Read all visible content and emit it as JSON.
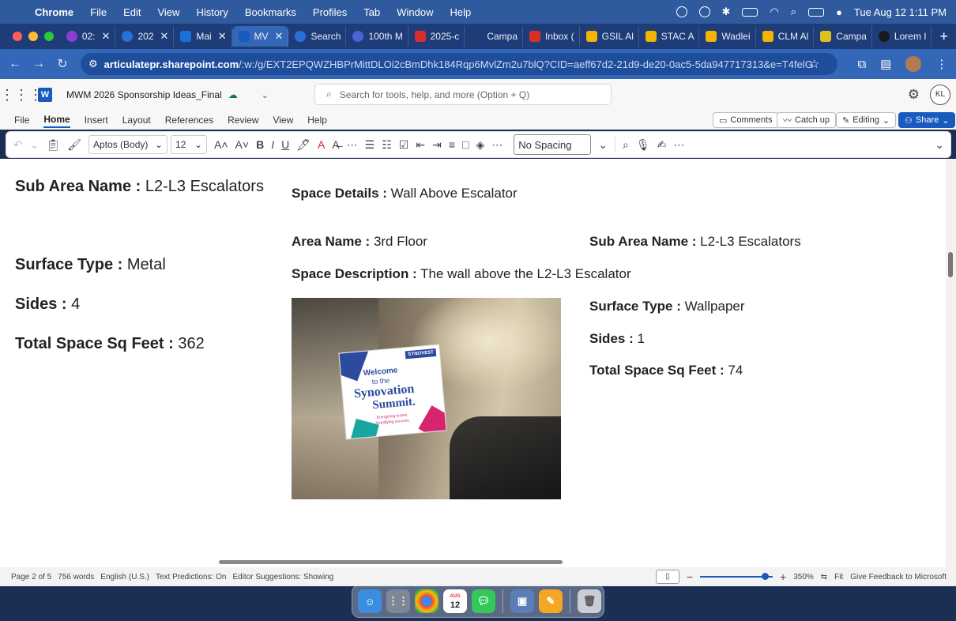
{
  "menubar": {
    "app": "Chrome",
    "items": [
      "File",
      "Edit",
      "View",
      "History",
      "Bookmarks",
      "Profiles",
      "Tab",
      "Window",
      "Help"
    ],
    "datetime": "Tue Aug 12  1:11 PM"
  },
  "tabs": [
    {
      "label": "02:",
      "color": "#8b3fd0"
    },
    {
      "label": "202",
      "color": "#2b6fd8"
    },
    {
      "label": "Mai",
      "color": "#1672d8"
    },
    {
      "label": "MV",
      "color": "#185abd"
    },
    {
      "label": "Search",
      "color": "#2b6fd8"
    },
    {
      "label": "100th M",
      "color": "#4a63d6"
    },
    {
      "label": "2025-c",
      "color": "#d92c2c"
    },
    {
      "label": "Campa",
      "color": "#1e3d78"
    },
    {
      "label": "Inbox (",
      "color": "#d93025"
    },
    {
      "label": "GSIL Al",
      "color": "#f4b400"
    },
    {
      "label": "STAC A",
      "color": "#f4b400"
    },
    {
      "label": "Wadlei",
      "color": "#f4b400"
    },
    {
      "label": "CLM Al",
      "color": "#f4b400"
    },
    {
      "label": "Campa",
      "color": "#e0c020"
    },
    {
      "label": "Lorem I",
      "color": "#1a1a1a"
    }
  ],
  "address": {
    "host": "articulatepr.sharepoint.com",
    "path": "/:w:/g/EXT2EPQWZHBPrMittDLOi2cBmDhk184Rqp6MvlZm2u7blQ?CID=aeff67d2-21d9-de20-0ac5-5da947717313&e=T4felG"
  },
  "word": {
    "doc_title": "MWM 2026 Sponsorship Ideas_Final",
    "search_placeholder": "Search for tools, help, and more (Option + Q)",
    "avatar": "KL",
    "ribbon_tabs": [
      "File",
      "Home",
      "Insert",
      "Layout",
      "References",
      "Review",
      "View",
      "Help"
    ],
    "comments": "Comments",
    "catchup": "Catch up",
    "editing": "Editing",
    "share": "Share",
    "font": "Aptos (Body)",
    "size": "12",
    "style": "No Spacing"
  },
  "document": {
    "left": {
      "sub_area_label": "Sub Area Name :",
      "sub_area_value": " L2-L3 Escalators",
      "surface_label": "Surface Type :",
      "surface_value": " Metal",
      "sides_label": "Sides :",
      "sides_value": " 4",
      "total_label": "Total Space Sq Feet :",
      "total_value": " 362"
    },
    "space_details_label": "Space Details :",
    "space_details_value": " Wall Above Escalator",
    "area_name_label": "Area Name :",
    "area_name_value": " 3rd Floor",
    "sub_area2_label": "Sub Area Name :",
    "sub_area2_value": " L2-L3 Escalators",
    "space_desc_label": "Space Description :",
    "space_desc_value": " The wall above the L2-L3 Escalator",
    "right": {
      "surface_label": "Surface Type :",
      "surface_value": " Wallpaper",
      "sides_label": "Sides :",
      "sides_value": " 1",
      "total_label": "Total Space Sq Feet :",
      "total_value": " 74"
    },
    "sign": {
      "brand": "SYNOVEST",
      "line1": "Welcome",
      "line2": "to the",
      "line3": "Synovation",
      "line4": "Summit.",
      "line5": "Energizing teams.",
      "line6": "Amplifying success."
    }
  },
  "status": {
    "page": "Page 2 of 5",
    "words": "756 words",
    "lang": "English (U.S.)",
    "predictions": "Text Predictions: On",
    "suggestions": "Editor Suggestions: Showing",
    "zoom": "350%",
    "fit": "Fit",
    "feedback": "Give Feedback to Microsoft",
    "zoom_level": 0.9
  },
  "dock": {
    "calendar_month": "AUG",
    "calendar_day": "12"
  }
}
